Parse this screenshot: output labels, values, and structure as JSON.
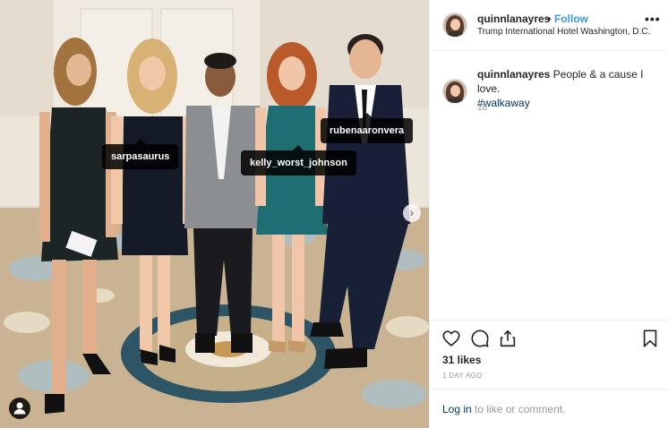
{
  "post": {
    "username": "quinnlanayres",
    "separator": "•",
    "follow_label": "Follow",
    "location": "Trump International Hotel Washington, D.C.",
    "more_label": "•••"
  },
  "photo": {
    "tags": [
      "sarpasaurus",
      "kelly_worst_johnson",
      "rubenaaronvera"
    ],
    "next_arrow": "›"
  },
  "caption": {
    "username": "quinnlanayres",
    "text": "People & a cause I love.",
    "hashtag": "#walkaway",
    "time": "1d"
  },
  "actions": {
    "icons": [
      "heart-icon",
      "comment-icon",
      "share-icon",
      "bookmark-icon"
    ],
    "likes": "31 likes",
    "posted_ago": "1 DAY AGO"
  },
  "login": {
    "link_text": "Log in",
    "rest_text": " to like or comment."
  },
  "colors": {
    "follow_blue": "#3897f0",
    "link_dark_blue": "#003569",
    "muted_gray": "#999999"
  }
}
